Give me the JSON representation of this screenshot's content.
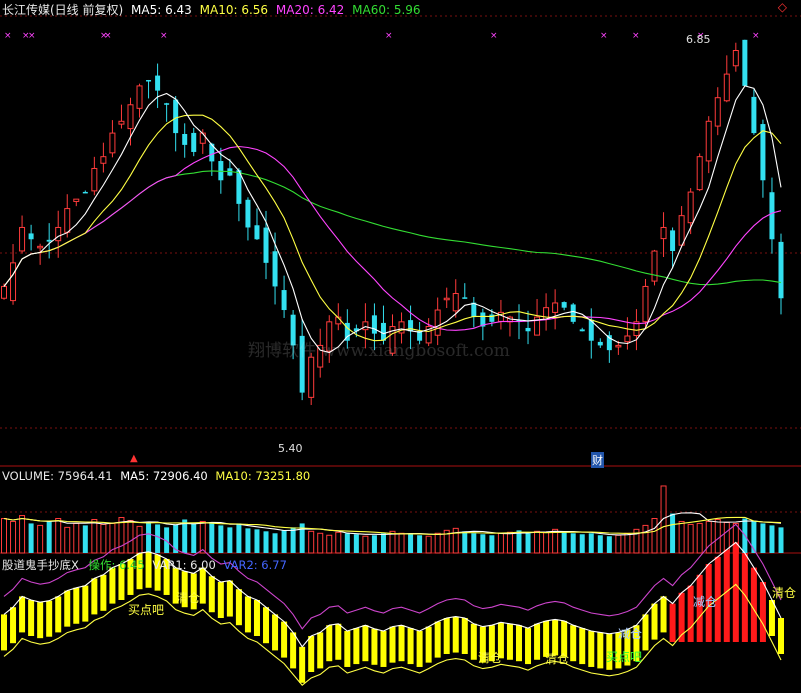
{
  "header": {
    "stock_name": "长江传媒(日线 前复权)",
    "ma5": "MA5: 6.43",
    "ma10": "MA10: 6.56",
    "ma20": "MA20: 6.42",
    "ma60": "MA60: 5.96"
  },
  "annotations": {
    "high": "6.85",
    "low": "5.40",
    "mark_left": "▲",
    "mark_cai": "财"
  },
  "volume_header": {
    "volume": "VOLUME: 75964.41",
    "ma5": "MA5: 72906.40",
    "ma10": "MA10: 73251.80"
  },
  "indicator_header": {
    "name": "股道鬼手抄底X",
    "op": "操作: 6.45",
    "var1": "VAR1: 6.00",
    "var2": "VAR2: 6.77"
  },
  "indicator_labels": {
    "buy": "买点吧",
    "clear": "清仓",
    "reduce": "减仓"
  },
  "watermark": "翔博软件 www.xiangbosoft.com",
  "colors": {
    "up": "#ff3b3b",
    "down": "#33e0f0",
    "ma5": "#ffffff",
    "ma10": "#ffff44",
    "ma20": "#ff44ff",
    "ma60": "#33dd33",
    "yellow_bar": "#ffff00",
    "red_bar": "#ff1a1a",
    "magenta": "#cc44cc"
  },
  "chart_data": {
    "type": "candlestick",
    "price_range": [
      5.25,
      6.92
    ],
    "closes": [
      5.85,
      5.95,
      6.1,
      6.05,
      6.02,
      6.04,
      6.1,
      6.18,
      6.22,
      6.25,
      6.35,
      6.4,
      6.5,
      6.55,
      6.62,
      6.7,
      6.72,
      6.68,
      6.62,
      6.5,
      6.45,
      6.42,
      6.5,
      6.38,
      6.3,
      6.32,
      6.2,
      6.1,
      6.05,
      5.95,
      5.85,
      5.75,
      5.6,
      5.4,
      5.55,
      5.6,
      5.7,
      5.72,
      5.62,
      5.66,
      5.7,
      5.65,
      5.62,
      5.68,
      5.7,
      5.66,
      5.62,
      5.68,
      5.75,
      5.8,
      5.82,
      5.8,
      5.72,
      5.68,
      5.7,
      5.74,
      5.72,
      5.7,
      5.66,
      5.72,
      5.76,
      5.78,
      5.76,
      5.7,
      5.66,
      5.62,
      5.6,
      5.58,
      5.6,
      5.64,
      5.7,
      5.85,
      6.0,
      6.1,
      6.0,
      6.15,
      6.25,
      6.4,
      6.55,
      6.65,
      6.75,
      6.85,
      6.7,
      6.5,
      6.3,
      6.05,
      5.8
    ],
    "volume": [
      3.5,
      3.2,
      3.8,
      3.0,
      2.8,
      3.2,
      3.5,
      2.6,
      3.0,
      2.8,
      3.4,
      2.9,
      3.0,
      3.6,
      3.3,
      2.7,
      3.2,
      2.9,
      2.6,
      2.9,
      3.4,
      3.0,
      3.2,
      3.0,
      2.8,
      2.6,
      3.0,
      2.5,
      2.4,
      2.2,
      2.0,
      2.3,
      2.6,
      3.0,
      2.2,
      2.0,
      1.8,
      2.1,
      2.0,
      1.9,
      1.7,
      1.8,
      2.0,
      2.2,
      2.0,
      1.9,
      1.8,
      1.7,
      2.0,
      2.3,
      2.5,
      2.2,
      2.0,
      1.9,
      1.8,
      2.0,
      2.1,
      2.3,
      2.0,
      2.2,
      2.1,
      2.4,
      2.2,
      2.0,
      1.9,
      2.0,
      1.8,
      1.7,
      1.8,
      2.0,
      2.4,
      2.8,
      3.5,
      6.8,
      4.0,
      3.2,
      2.9,
      3.0,
      3.2,
      3.4,
      3.1,
      3.0,
      3.5,
      3.2,
      3.0,
      2.8,
      2.6
    ],
    "vol_ylim": [
      0,
      7
    ]
  }
}
